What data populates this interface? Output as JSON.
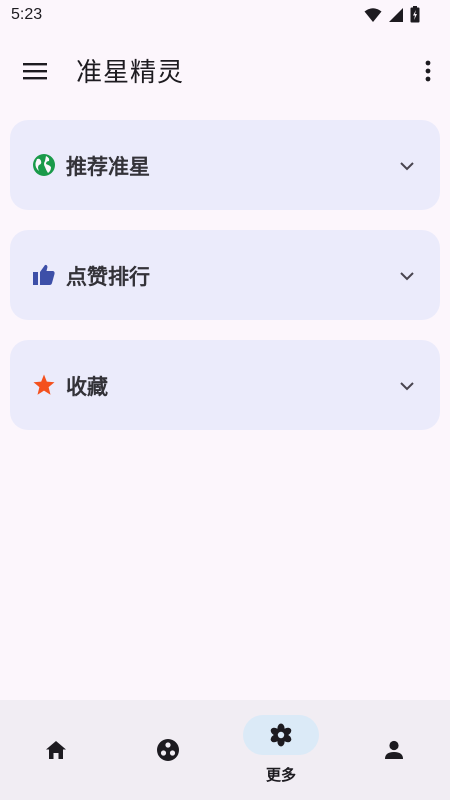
{
  "status_bar": {
    "time": "5:23",
    "icons": [
      "wifi-icon",
      "signal-icon",
      "battery-icon"
    ]
  },
  "app_bar": {
    "title": "准星精灵",
    "left_icon": "menu-icon",
    "right_icon": "more-vert-icon"
  },
  "sections": [
    {
      "label": "推荐准星",
      "icon": "globe-icon",
      "icon_color": "#1a9a4a",
      "expand_icon": "chevron-down-icon"
    },
    {
      "label": "点赞排行",
      "icon": "thumb-up-icon",
      "icon_color": "#3d4fa8",
      "expand_icon": "chevron-down-icon"
    },
    {
      "label": "收藏",
      "icon": "star-icon",
      "icon_color": "#f4511e",
      "expand_icon": "chevron-down-icon"
    }
  ],
  "bottom_nav": {
    "items": [
      {
        "icon": "home-icon",
        "label": ""
      },
      {
        "icon": "scatter-icon",
        "label": ""
      },
      {
        "icon": "flower-icon",
        "label": "更多",
        "active": true
      },
      {
        "icon": "person-icon",
        "label": ""
      }
    ]
  },
  "colors": {
    "background": "#fcf6fc",
    "card": "#ebebfb",
    "nav_bar": "#f1edf3",
    "active_pill": "#dbeaf7"
  }
}
